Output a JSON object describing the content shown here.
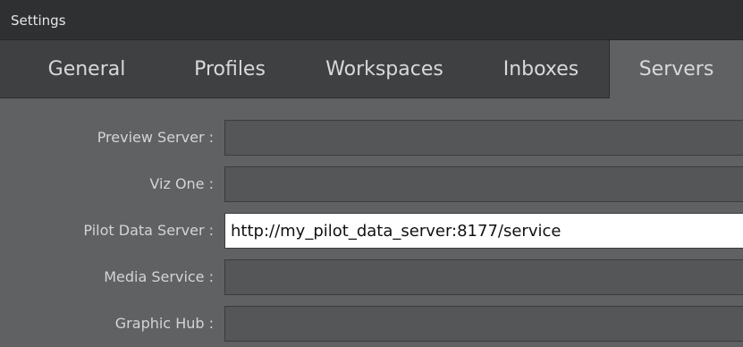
{
  "window": {
    "title": "Settings"
  },
  "tabs": [
    {
      "label": "General",
      "active": false
    },
    {
      "label": "Profiles",
      "active": false
    },
    {
      "label": "Workspaces",
      "active": false
    },
    {
      "label": "Inboxes",
      "active": false
    },
    {
      "label": "Servers",
      "active": true
    }
  ],
  "form": {
    "fields": [
      {
        "label": "Preview Server :",
        "value": ""
      },
      {
        "label": "Viz One :",
        "value": ""
      },
      {
        "label": "Pilot Data Server :",
        "value": "http://my_pilot_data_server:8177/service"
      },
      {
        "label": "Media Service :",
        "value": ""
      },
      {
        "label": "Graphic Hub :",
        "value": ""
      }
    ]
  },
  "colors": {
    "titlebar": "#2f3032",
    "tabbar": "#3e4042",
    "panel": "#5f6163",
    "field_empty": "#545658",
    "field_filled": "#ffffff"
  }
}
